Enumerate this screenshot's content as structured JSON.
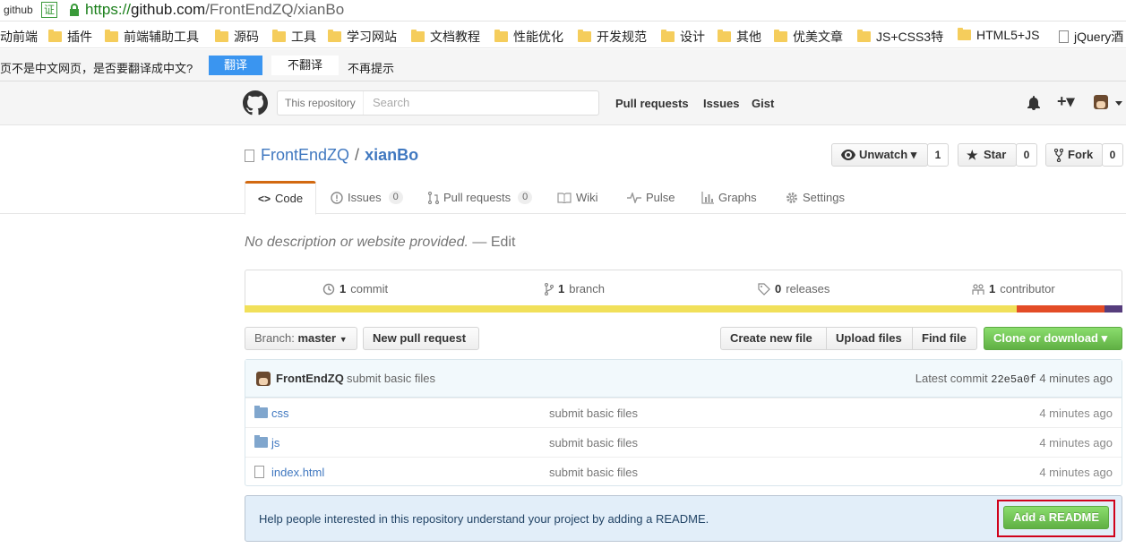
{
  "browser": {
    "site_tag": "github",
    "cert_label": "证",
    "url_scheme": "https://",
    "url_host": "github.com",
    "url_path": "/FrontEndZQ/xianBo"
  },
  "bookmarks": [
    {
      "label": "动前端",
      "type": "none"
    },
    {
      "label": "插件",
      "type": "folder"
    },
    {
      "label": "前端辅助工具",
      "type": "folder"
    },
    {
      "label": "源码",
      "type": "folder"
    },
    {
      "label": "工具",
      "type": "folder"
    },
    {
      "label": "学习网站",
      "type": "folder"
    },
    {
      "label": "文档教程",
      "type": "folder"
    },
    {
      "label": "性能优化",
      "type": "folder"
    },
    {
      "label": "开发规范",
      "type": "folder"
    },
    {
      "label": "设计",
      "type": "folder"
    },
    {
      "label": "其他",
      "type": "folder"
    },
    {
      "label": "优美文章",
      "type": "folder"
    },
    {
      "label": "JS+CSS3特",
      "type": "folder"
    },
    {
      "label": "HTML5+JS",
      "type": "folder"
    },
    {
      "label": "jQuery酒",
      "type": "page"
    }
  ],
  "translate_bar": {
    "message": "页不是中文网页，是否要翻译成中文?",
    "translate_label": "翻译",
    "no_translate_label": "不翻译",
    "never_label": "不再提示"
  },
  "header": {
    "search_scope": "This repository",
    "search_placeholder": "Search",
    "nav": [
      "Pull requests",
      "Issues",
      "Gist"
    ],
    "new_label": "+▾"
  },
  "repo": {
    "owner": "FrontEndZQ",
    "separator": "/",
    "name": "xianBo",
    "watch_label": "Unwatch ▾",
    "watch_count": "1",
    "star_label": "Star",
    "star_count": "0",
    "fork_label": "Fork",
    "fork_count": "0"
  },
  "tabs": [
    {
      "label": "Code",
      "icon": "code-icon",
      "count": ""
    },
    {
      "label": "Issues",
      "icon": "issue-icon",
      "count": "0"
    },
    {
      "label": "Pull requests",
      "icon": "pull-request-icon",
      "count": "0"
    },
    {
      "label": "Wiki",
      "icon": "book-icon",
      "count": ""
    },
    {
      "label": "Pulse",
      "icon": "pulse-icon",
      "count": ""
    },
    {
      "label": "Graphs",
      "icon": "graph-icon",
      "count": ""
    },
    {
      "label": "Settings",
      "icon": "gear-icon",
      "count": ""
    }
  ],
  "description": {
    "text": "No description or website provided.",
    "dash": "—",
    "edit_label": "Edit"
  },
  "stats": {
    "commits_num": "1",
    "commits_label": "commit",
    "branches_num": "1",
    "branches_label": "branch",
    "releases_num": "0",
    "releases_label": "releases",
    "contributors_num": "1",
    "contributors_label": "contributor"
  },
  "language_bar": [
    {
      "color": "#f1e05a",
      "percent": 88
    },
    {
      "color": "#e34c26",
      "percent": 10
    },
    {
      "color": "#563d7c",
      "percent": 2
    }
  ],
  "file_nav": {
    "branch_prefix": "Branch:",
    "branch_name": "master",
    "new_pr_label": "New pull request",
    "create_file_label": "Create new file",
    "upload_label": "Upload files",
    "find_label": "Find file",
    "clone_label": "Clone or download ▾"
  },
  "commit_tease": {
    "author": "FrontEndZQ",
    "message": "submit basic files",
    "latest_label": "Latest commit",
    "sha": "22e5a0f",
    "age": "4 minutes ago"
  },
  "files": [
    {
      "name": "css",
      "type": "dir",
      "message": "submit basic files",
      "age": "4 minutes ago"
    },
    {
      "name": "js",
      "type": "dir",
      "message": "submit basic files",
      "age": "4 minutes ago"
    },
    {
      "name": "index.html",
      "type": "file",
      "message": "submit basic files",
      "age": "4 minutes ago"
    }
  ],
  "readme_prompt": {
    "text": "Help people interested in this repository understand your project by adding a README.",
    "button_label": "Add a README"
  }
}
